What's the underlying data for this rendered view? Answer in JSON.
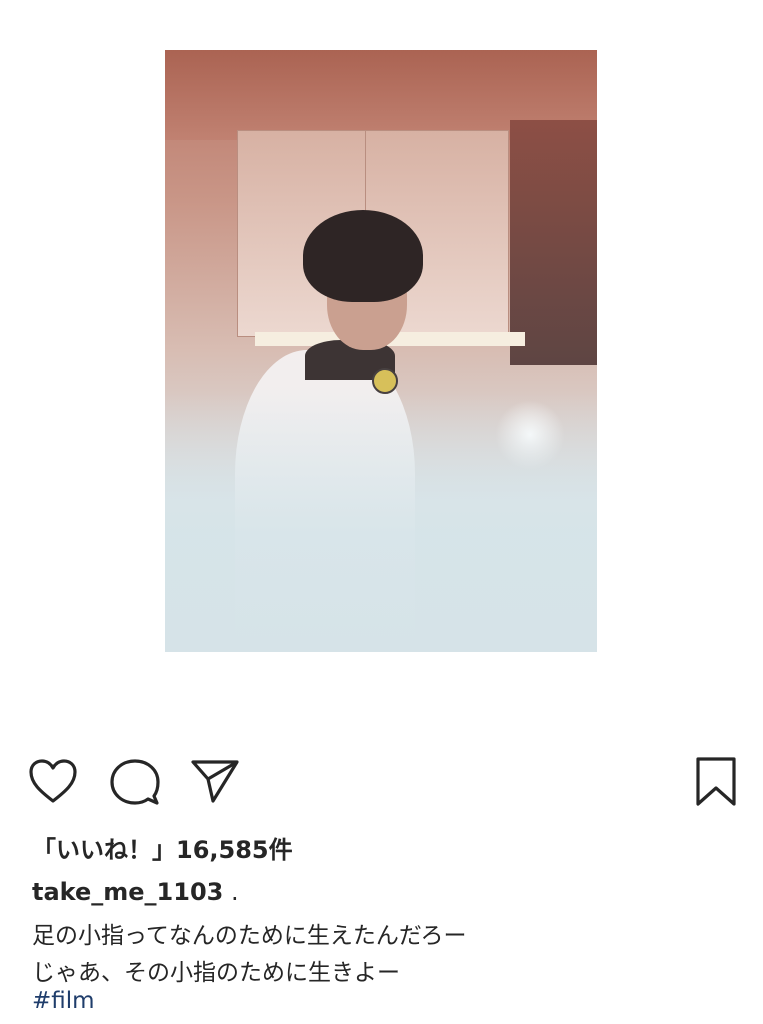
{
  "post": {
    "likes_text": "「いいね！」16,585件",
    "username": "take_me_1103",
    "username_suffix": " .",
    "caption_lines": [
      "足の小指ってなんのために生えたんだろー",
      "じゃあ、その小指のために生きよー"
    ],
    "hashtag": "#film"
  },
  "actions": {
    "like_icon": "heart-icon",
    "comment_icon": "comment-bubble-icon",
    "share_icon": "paper-plane-icon",
    "save_icon": "bookmark-icon"
  },
  "colors": {
    "text": "#262626",
    "hashtag": "#1f3d6b",
    "background": "#ffffff"
  }
}
